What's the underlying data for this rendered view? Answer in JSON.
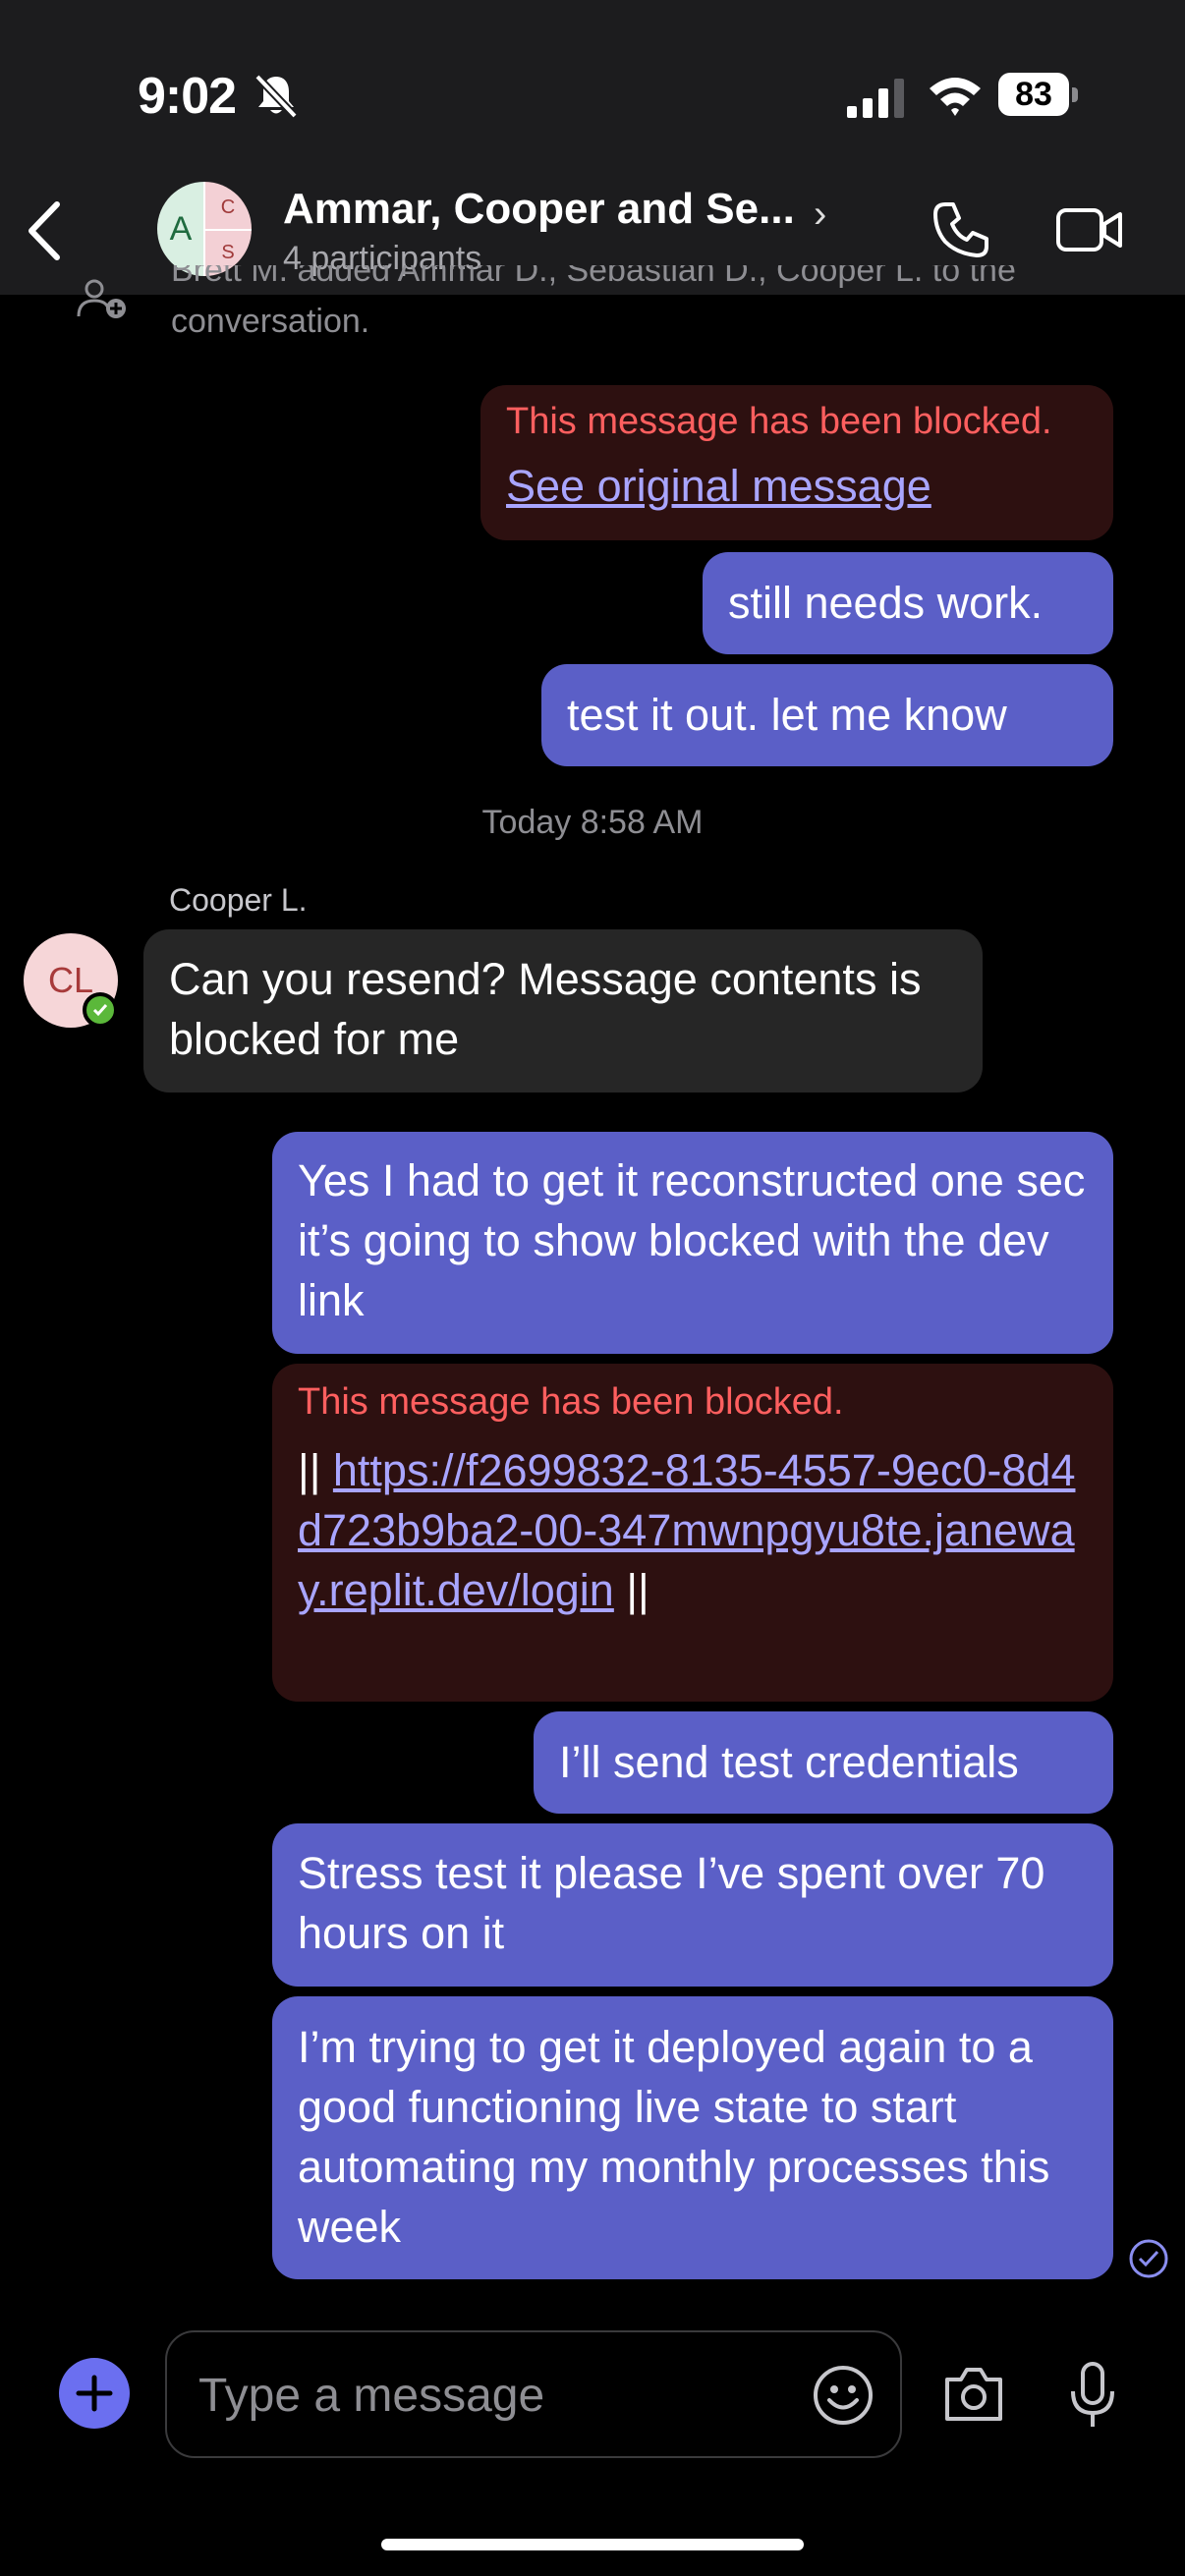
{
  "status_bar": {
    "time": "9:02",
    "battery": "83"
  },
  "header": {
    "title": "Ammar, Cooper and Se...",
    "subtitle": "4 participants",
    "avatar_initials": [
      "A",
      "C",
      "S"
    ]
  },
  "system_message": {
    "line1": "Brett M. added Ammar D., Sebastian D., Cooper L. to the",
    "line2": "conversation."
  },
  "messages": {
    "m1": {
      "blocked_label": "This message has been blocked.",
      "link": "See original message"
    },
    "m2": {
      "text": "still needs work."
    },
    "m3": {
      "text": "test it out. let me know"
    },
    "timestamp": "Today 8:58 AM",
    "m4": {
      "sender": "Cooper L.",
      "initials": "CL",
      "text": "Can you resend? Message contents is blocked for me"
    },
    "m5": {
      "text": "Yes I had to get it reconstructed one sec it’s going to show blocked with the dev link"
    },
    "m6": {
      "blocked_label": "This message has been blocked.",
      "prefix": "|| ",
      "link": "https://f2699832-8135-4557-9ec0-8d4d723b9ba2-00-347mwnpgyu8te.janeway.replit.dev/login",
      "suffix": " ||"
    },
    "m7": {
      "text": "I’ll send test credentials"
    },
    "m8": {
      "text": "Stress test it please I’ve spent over 70 hours on it"
    },
    "m9": {
      "text": "I’m trying to get it deployed again to a good functioning live state to start automating my monthly processes this week"
    }
  },
  "composer": {
    "placeholder": "Type a message"
  },
  "icons": [
    "bell-slash-icon",
    "signal-icon",
    "wifi-icon",
    "back-icon",
    "chevron-right-icon",
    "phone-icon",
    "video-icon",
    "add-person-icon",
    "check-icon",
    "read-receipt-icon",
    "plus-icon",
    "emoji-icon",
    "camera-icon",
    "mic-icon"
  ],
  "colors": {
    "outgoing": "#5b5fc7",
    "incoming": "#262626",
    "blocked_bg": "#2d1010",
    "blocked_text": "#ff5f5f",
    "link": "#a9a5ff"
  }
}
